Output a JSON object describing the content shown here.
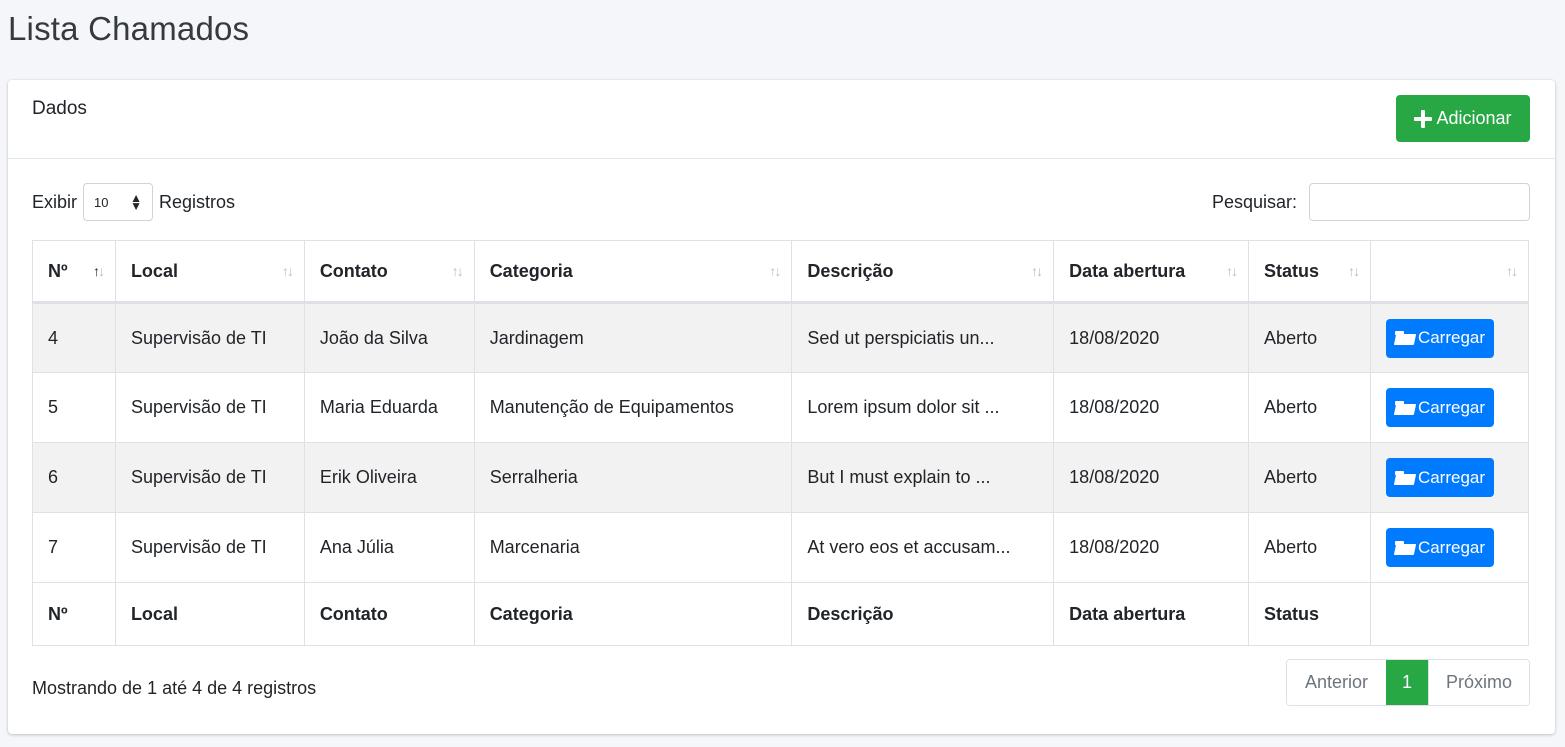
{
  "page": {
    "title": "Lista Chamados"
  },
  "card": {
    "title": "Dados",
    "add_button": "Adicionar",
    "length_label_before": "Exibir",
    "length_value": "10",
    "length_label_after": "Registros",
    "search_label": "Pesquisar:",
    "search_value": ""
  },
  "table": {
    "columns": [
      "Nº",
      "Local",
      "Contato",
      "Categoria",
      "Descrição",
      "Data abertura",
      "Status",
      ""
    ],
    "sorted_column": "Nº",
    "sort_direction": "asc",
    "rows": [
      {
        "num": "4",
        "local": "Supervisão de TI",
        "contato": "João da Silva",
        "categoria": "Jardinagem",
        "descricao": "Sed ut perspiciatis un...",
        "data": "18/08/2020",
        "status": "Aberto",
        "action": "Carregar"
      },
      {
        "num": "5",
        "local": "Supervisão de TI",
        "contato": "Maria Eduarda",
        "categoria": "Manutenção de Equipamentos",
        "descricao": "Lorem ipsum dolor sit ...",
        "data": "18/08/2020",
        "status": "Aberto",
        "action": "Carregar"
      },
      {
        "num": "6",
        "local": "Supervisão de TI",
        "contato": "Erik Oliveira",
        "categoria": "Serralheria",
        "descricao": "But I must explain to ...",
        "data": "18/08/2020",
        "status": "Aberto",
        "action": "Carregar"
      },
      {
        "num": "7",
        "local": "Supervisão de TI",
        "contato": "Ana Júlia",
        "categoria": "Marcenaria",
        "descricao": "At vero eos et accusam...",
        "data": "18/08/2020",
        "status": "Aberto",
        "action": "Carregar"
      }
    ],
    "footer_columns": [
      "Nº",
      "Local",
      "Contato",
      "Categoria",
      "Descrição",
      "Data abertura",
      "Status",
      ""
    ]
  },
  "footer": {
    "info": "Mostrando de 1 até 4 de 4 registros",
    "prev": "Anterior",
    "current_page": "1",
    "next": "Próximo"
  },
  "colors": {
    "success": "#28a745",
    "primary": "#007bff",
    "striped_row": "#f2f2f2"
  },
  "icons": {
    "add": "plus-icon",
    "load": "folder-open-icon",
    "sort": "sort-arrows-icon"
  }
}
